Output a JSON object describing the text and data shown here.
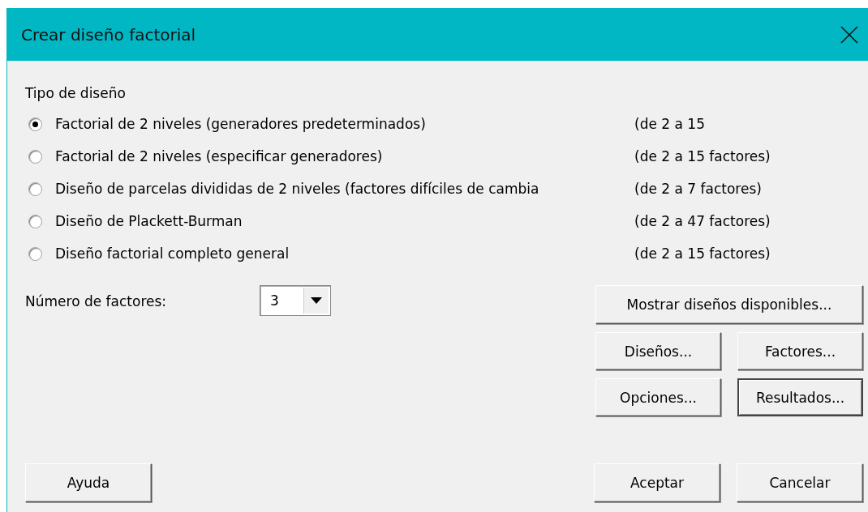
{
  "window": {
    "title": "Crear diseño factorial"
  },
  "design_type": {
    "label": "Tipo de diseño",
    "options": [
      {
        "label": "Factorial de 2 niveles (generadores predeterminados)",
        "range": "(de 2 a 15",
        "selected": true
      },
      {
        "label": "Factorial de 2 niveles (especificar generadores)",
        "range": "(de 2 a 15 factores)",
        "selected": false
      },
      {
        "label": "Diseño de parcelas divididas de 2 niveles (factores difíciles de cambia",
        "range": "(de 2 a 7 factores)",
        "selected": false
      },
      {
        "label": "Diseño de Plackett-Burman",
        "range": "(de 2 a 47 factores)",
        "selected": false
      },
      {
        "label": "Diseño factorial completo general",
        "range": "(de 2 a 15 factores)",
        "selected": false
      }
    ]
  },
  "factors": {
    "label": "Número de factores:",
    "value": "3"
  },
  "buttons": [
    {
      "label": "Mostrar diseños disponibles...",
      "default": false
    },
    {
      "label": "Diseños...",
      "default": false
    },
    {
      "label": "Factores...",
      "default": false
    },
    {
      "label": "Opciones...",
      "default": false
    },
    {
      "label": "Resultados...",
      "default": true
    }
  ],
  "footer": {
    "help": "Ayuda",
    "ok": "Aceptar",
    "cancel": "Cancelar"
  }
}
